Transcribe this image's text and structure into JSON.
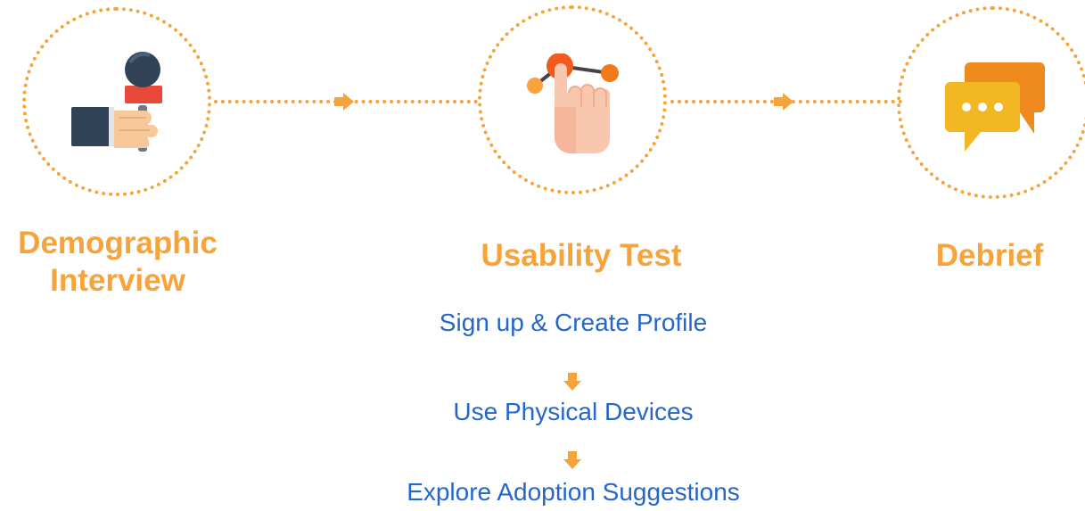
{
  "stages": [
    {
      "id": "demographic",
      "title_lines": [
        "Demographic",
        "Interview"
      ],
      "icon": "microphone-hand-icon"
    },
    {
      "id": "usability",
      "title_lines": [
        "Usability Test"
      ],
      "icon": "touch-gesture-icon"
    },
    {
      "id": "debrief",
      "title_lines": [
        "Debrief"
      ],
      "icon": "chat-bubbles-icon"
    }
  ],
  "usability_steps": [
    "Sign up & Create Profile",
    "Use Physical Devices",
    "Explore Adoption Suggestions"
  ],
  "colors": {
    "accent": "#f6a33c",
    "step_text": "#2466c9"
  }
}
